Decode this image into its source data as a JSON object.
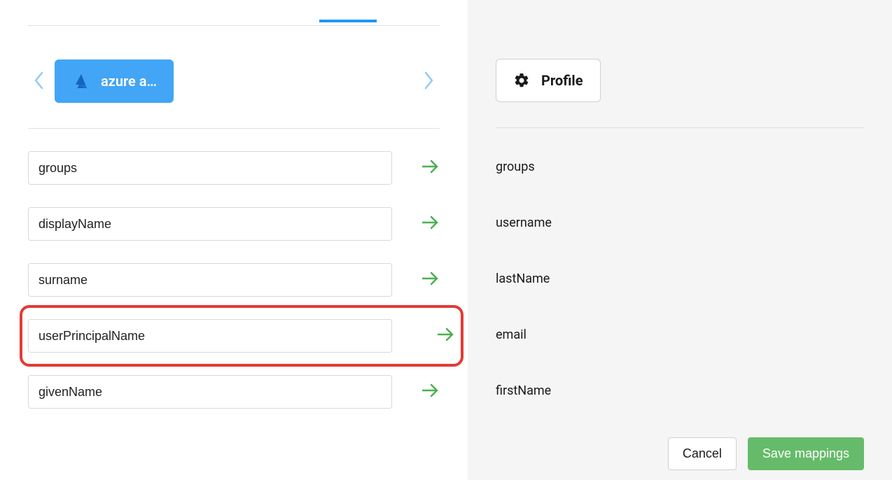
{
  "source": {
    "label": "azure a…"
  },
  "target": {
    "label": "Profile"
  },
  "mappings": {
    "0": {
      "source": "groups",
      "target": "groups",
      "highlighted": false
    },
    "1": {
      "source": "displayName",
      "target": "username",
      "highlighted": false
    },
    "2": {
      "source": "surname",
      "target": "lastName",
      "highlighted": false
    },
    "3": {
      "source": "userPrincipalName",
      "target": "email",
      "highlighted": true
    },
    "4": {
      "source": "givenName",
      "target": "firstName",
      "highlighted": false
    }
  },
  "actions": {
    "cancel": "Cancel",
    "save": "Save mappings"
  },
  "colors": {
    "accent": "#42A5F5",
    "success": "#66BB6A",
    "highlight": "#E53935",
    "arrow": "#4CAF50",
    "chevron": "#90CAF9"
  }
}
